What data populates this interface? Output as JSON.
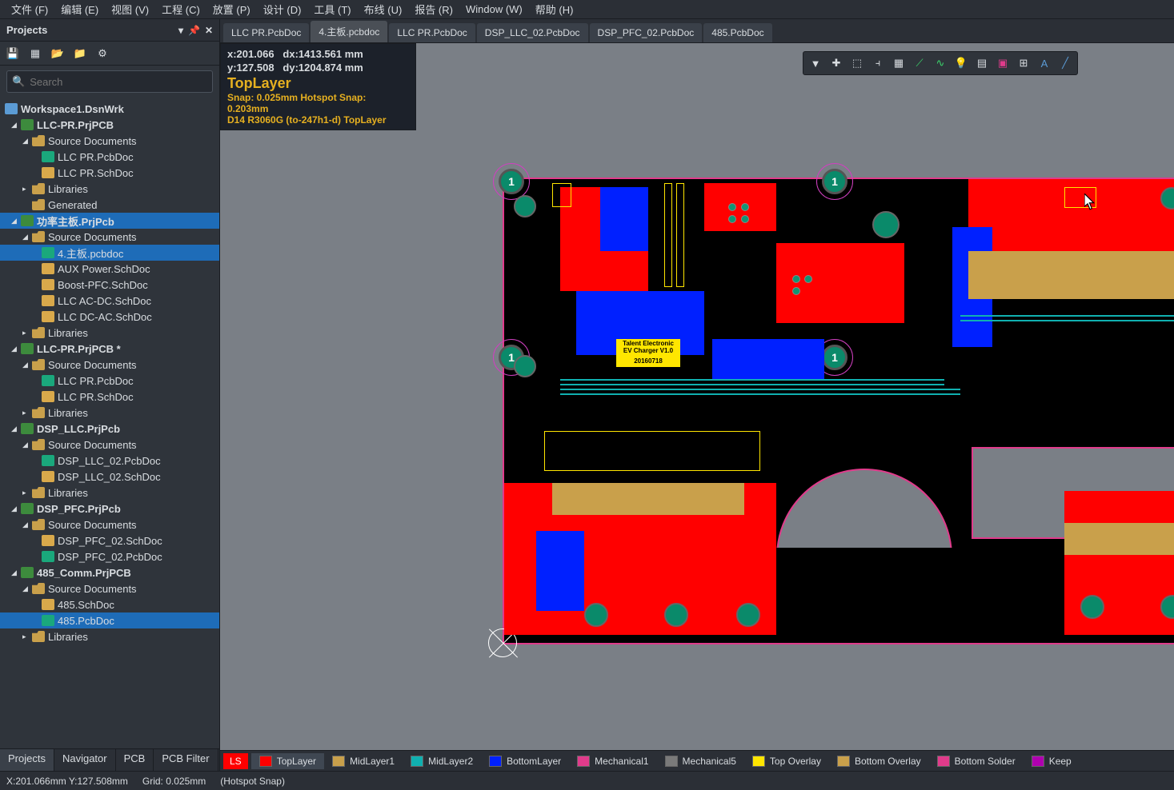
{
  "menu": {
    "file": "文件 (F)",
    "edit": "编辑 (E)",
    "view": "视图 (V)",
    "project": "工程 (C)",
    "place": "放置 (P)",
    "design": "设计 (D)",
    "tools": "工具 (T)",
    "route": "布线 (U)",
    "reports": "报告 (R)",
    "window": "Window (W)",
    "help": "帮助 (H)"
  },
  "panel": {
    "title": "Projects",
    "search_placeholder": "Search",
    "bottom_tabs": [
      "Projects",
      "Navigator",
      "PCB",
      "PCB Filter"
    ]
  },
  "tree": {
    "workspace": "Workspace1.DsnWrk",
    "p1": {
      "name": "LLC-PR.PrjPCB",
      "src": "Source Documents",
      "f1": "LLC PR.PcbDoc",
      "f2": "LLC PR.SchDoc",
      "lib": "Libraries",
      "gen": "Generated"
    },
    "p2": {
      "name": "功率主板.PrjPcb",
      "src": "Source Documents",
      "f1": "4.主板.pcbdoc",
      "f2": "AUX Power.SchDoc",
      "f3": "Boost-PFC.SchDoc",
      "f4": "LLC AC-DC.SchDoc",
      "f5": "LLC DC-AC.SchDoc",
      "lib": "Libraries"
    },
    "p3": {
      "name": "LLC-PR.PrjPCB *",
      "src": "Source Documents",
      "f1": "LLC PR.PcbDoc",
      "f2": "LLC PR.SchDoc",
      "lib": "Libraries"
    },
    "p4": {
      "name": "DSP_LLC.PrjPcb",
      "src": "Source Documents",
      "f1": "DSP_LLC_02.PcbDoc",
      "f2": "DSP_LLC_02.SchDoc",
      "lib": "Libraries"
    },
    "p5": {
      "name": "DSP_PFC.PrjPcb",
      "src": "Source Documents",
      "f1": "DSP_PFC_02.SchDoc",
      "f2": "DSP_PFC_02.PcbDoc"
    },
    "p6": {
      "name": "485_Comm.PrjPCB",
      "src": "Source Documents",
      "f1": "485.SchDoc",
      "f2": "485.PcbDoc",
      "lib": "Libraries"
    }
  },
  "tabs": [
    {
      "label": "LLC PR.PcbDoc"
    },
    {
      "label": "4.主板.pcbdoc"
    },
    {
      "label": "LLC PR.PcbDoc"
    },
    {
      "label": "DSP_LLC_02.PcbDoc"
    },
    {
      "label": "DSP_PFC_02.PcbDoc"
    },
    {
      "label": "485.PcbDoc"
    }
  ],
  "hud": {
    "x": "x:201.066",
    "dx": "dx:1413.561 mm",
    "y": "y:127.508",
    "dy": "dy:1204.874 mm",
    "layer": "TopLayer",
    "snap": "Snap: 0.025mm Hotspot Snap: 0.203mm",
    "obj": "D14 R3060G (to-247h1-d) TopLayer"
  },
  "pcb_silk": {
    "title1": "Talent Electronic",
    "title2": "EV Charger V1.0",
    "date": "20160718"
  },
  "layers": {
    "ls": "LS",
    "top": "TopLayer",
    "mid1": "MidLayer1",
    "mid2": "MidLayer2",
    "bottom": "BottomLayer",
    "mech1": "Mechanical1",
    "mech5": "Mechanical5",
    "topover": "Top Overlay",
    "botover": "Bottom Overlay",
    "botsolder": "Bottom Solder",
    "keep": "Keep",
    "colors": {
      "top": "#ff0000",
      "mid1": "#c9a04b",
      "mid2": "#10b0b0",
      "bottom": "#0020ff",
      "mech1": "#e03b8b",
      "mech5": "#7a7a7a",
      "topover": "#ffe600",
      "botover": "#c9a04b",
      "botsolder": "#e03b8b",
      "keep": "#b000b0"
    }
  },
  "status": {
    "coord": "X:201.066mm Y:127.508mm",
    "grid": "Grid: 0.025mm",
    "snap": "(Hotspot Snap)"
  }
}
